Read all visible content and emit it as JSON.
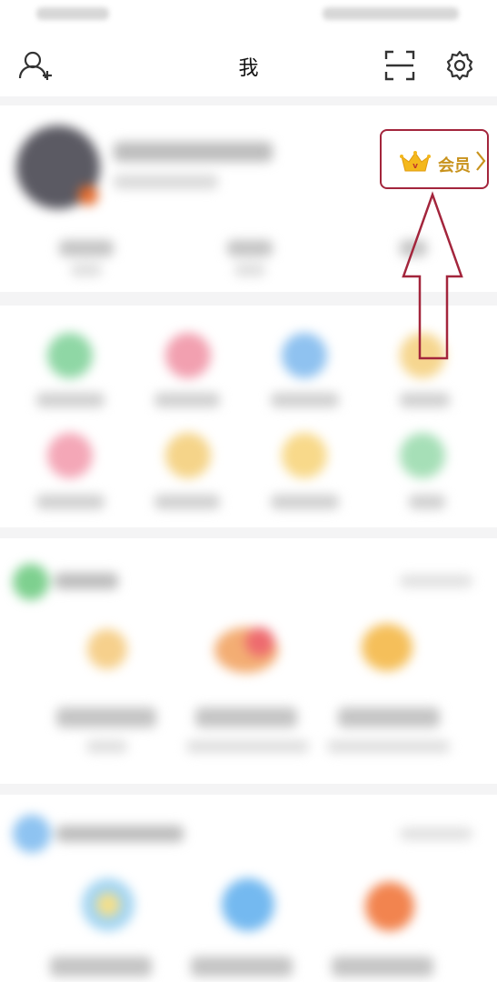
{
  "header": {
    "title": "我",
    "add_friend_icon": "add-user-icon",
    "scan_icon": "scan-icon",
    "settings_icon": "gear-icon"
  },
  "profile": {
    "member_label": "会员",
    "member_icon": "crown-icon",
    "accent": "#c8921c",
    "highlight_color": "#a3253c"
  }
}
